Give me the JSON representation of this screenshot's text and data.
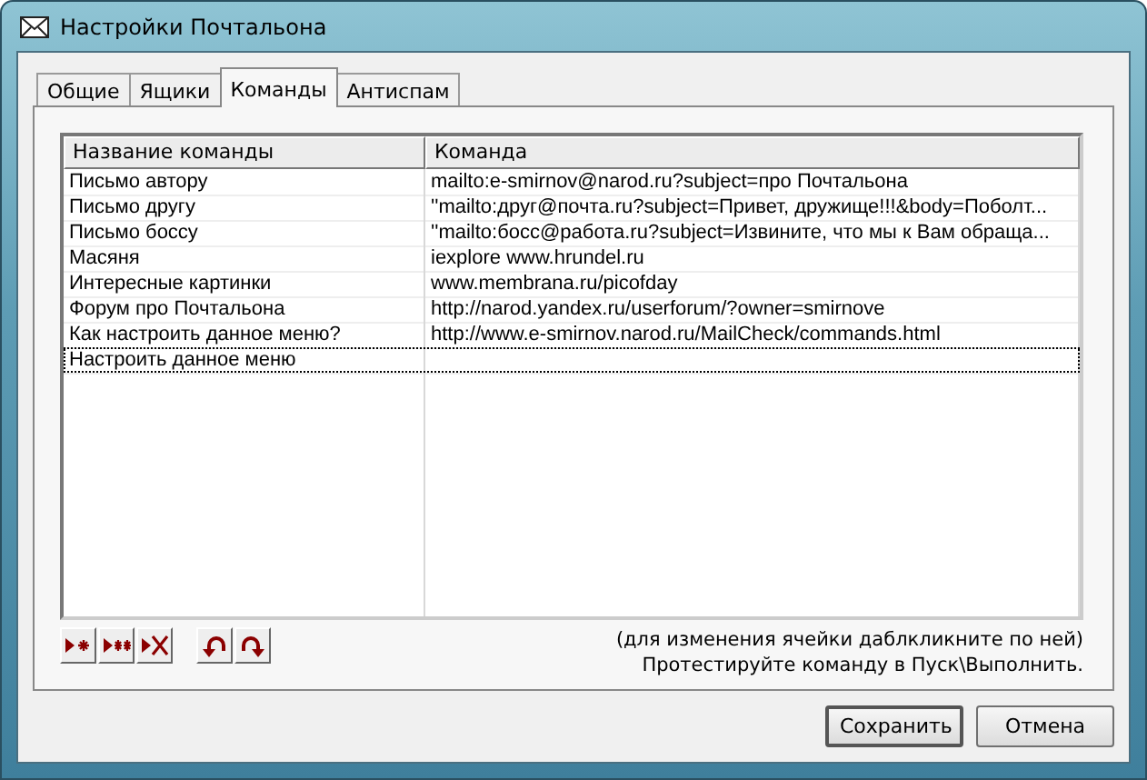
{
  "window": {
    "title": "Настройки Почтальона"
  },
  "tabs": [
    {
      "label": "Общие",
      "selected": false
    },
    {
      "label": "Ящики",
      "selected": false
    },
    {
      "label": "Команды",
      "selected": true
    },
    {
      "label": "Антиспам",
      "selected": false
    }
  ],
  "table": {
    "columns": [
      "Название команды",
      "Команда"
    ],
    "rows": [
      {
        "name": "Письмо автору",
        "command": "mailto:e-smirnov@narod.ru?subject=про Почтальона",
        "focused": false
      },
      {
        "name": "Письмо другу",
        "command": "''mailto:друг@почта.ru?subject=Привет, дружище!!!&body=Поболт...",
        "focused": false
      },
      {
        "name": "Письмо боссу",
        "command": "''mailto:босс@работа.ru?subject=Извините, что мы к Вам обраща...",
        "focused": false
      },
      {
        "name": "Масяня",
        "command": "iexplore www.hrundel.ru",
        "focused": false
      },
      {
        "name": "Интересные картинки",
        "command": "www.membrana.ru/picofday",
        "focused": false
      },
      {
        "name": "Форум про Почтальона",
        "command": "http://narod.yandex.ru/userforum/?owner=smirnove",
        "focused": false
      },
      {
        "name": "Как настроить данное меню?",
        "command": "http://www.e-smirnov.narod.ru/MailCheck/commands.html",
        "focused": false
      },
      {
        "name": "Настроить данное меню",
        "command": "",
        "focused": true
      }
    ]
  },
  "toolbar": [
    [
      {
        "kind": "add"
      },
      {
        "kind": "add_many"
      },
      {
        "kind": "delete"
      }
    ],
    [
      {
        "kind": "undo"
      },
      {
        "kind": "redo"
      }
    ]
  ],
  "hints": [
    "(для изменения ячейки  даблкликните по ней)",
    "Протестируйте команду в Пуск\\Выполнить."
  ],
  "buttons": [
    "Сохранить",
    "Отмена"
  ]
}
